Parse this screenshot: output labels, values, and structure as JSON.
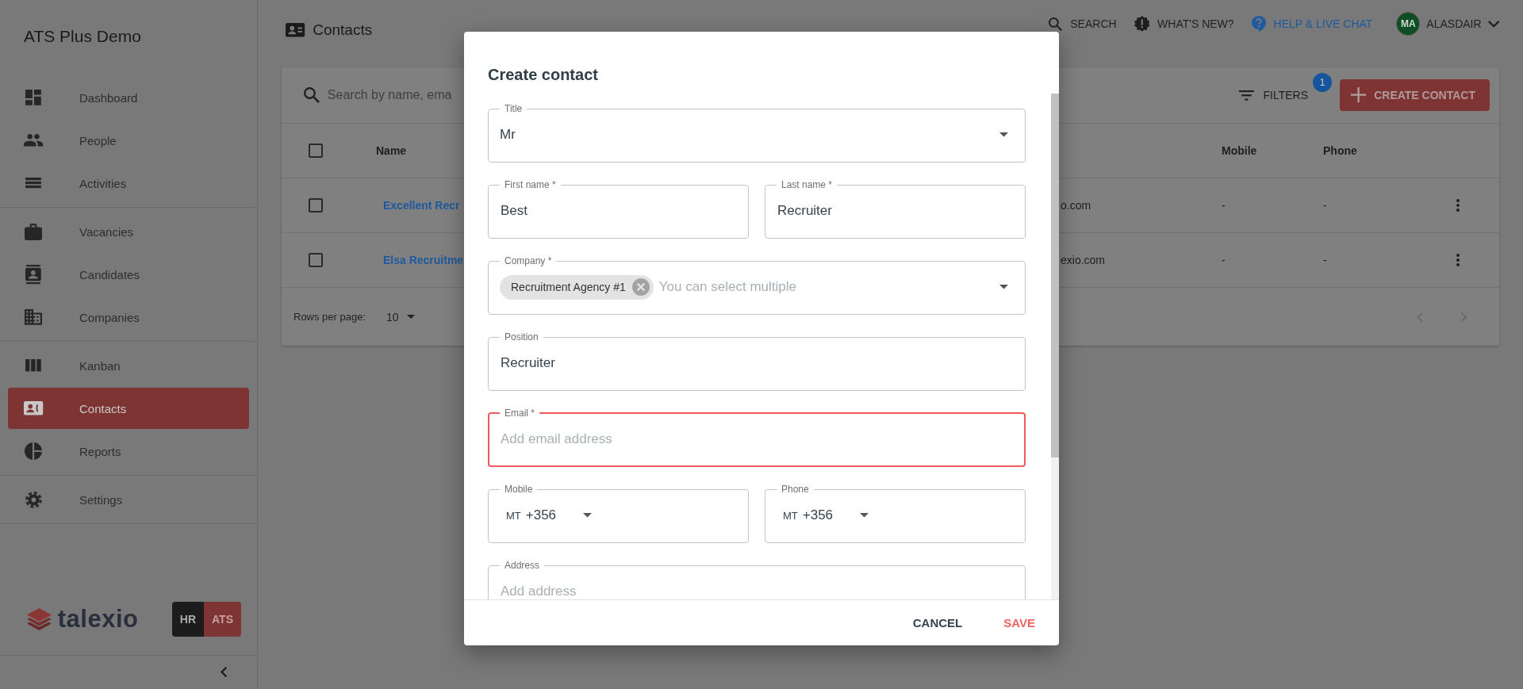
{
  "sidebar": {
    "title": "ATS Plus Demo",
    "sections": [
      {
        "items": [
          {
            "label": "Dashboard",
            "selected": false
          },
          {
            "label": "People",
            "selected": false
          },
          {
            "label": "Activities",
            "selected": false
          }
        ]
      },
      {
        "items": [
          {
            "label": "Vacancies",
            "selected": false
          },
          {
            "label": "Candidates",
            "selected": false
          },
          {
            "label": "Companies",
            "selected": false
          }
        ]
      },
      {
        "items": [
          {
            "label": "Kanban",
            "selected": false
          },
          {
            "label": "Contacts",
            "selected": true
          },
          {
            "label": "Reports",
            "selected": false
          }
        ]
      },
      {
        "items": [
          {
            "label": "Settings",
            "selected": false
          }
        ]
      }
    ],
    "logo": "talexio",
    "product_switch": [
      {
        "label": "HR",
        "selected": false
      },
      {
        "label": "ATS",
        "selected": true
      }
    ]
  },
  "header": {
    "title": "Contacts",
    "actions": [
      {
        "label": "SEARCH"
      },
      {
        "label": "WHAT'S NEW?"
      },
      {
        "label": "HELP & LIVE CHAT"
      }
    ],
    "user": {
      "initials": "MA",
      "name": "ALASDAIR"
    }
  },
  "toolbar": {
    "search_placeholder": "Search by name, ema",
    "filters": "FILTERS",
    "filter_count": "1",
    "create_button": "CREATE CONTACT"
  },
  "table": {
    "all_checked": false,
    "columns": [
      "Name",
      "Mobile",
      "Phone"
    ],
    "rows": [
      {
        "checked": false,
        "name": "Excellent Recr",
        "email": "o.com",
        "mobile": "-",
        "phone": "-"
      },
      {
        "checked": false,
        "name": "Elsa Recruitme",
        "email": "exio.com",
        "mobile": "-",
        "phone": "-"
      }
    ],
    "rows_per_page_label": "Rows per page:",
    "rows_per_page": "10"
  },
  "dialog": {
    "title": "Create contact",
    "rows": [
      [
        {
          "kind": "select",
          "label": "Title",
          "value": "Mr"
        }
      ],
      [
        {
          "kind": "text",
          "label": "First name *",
          "value": "Best"
        },
        {
          "kind": "text",
          "label": "Last name *",
          "value": "Recruiter"
        }
      ],
      [
        {
          "kind": "chips",
          "label": "Company *",
          "chips": [
            "Recruitment Agency #1"
          ],
          "placeholder": "You can select multiple"
        }
      ],
      [
        {
          "kind": "text",
          "label": "Position",
          "value": "Recruiter"
        }
      ],
      [
        {
          "kind": "text",
          "label": "Email *",
          "placeholder": "Add email address",
          "error": true
        }
      ],
      [
        {
          "kind": "phone",
          "label": "Mobile",
          "country": "MT",
          "code": "+356"
        },
        {
          "kind": "phone",
          "label": "Phone",
          "country": "MT",
          "code": "+356"
        }
      ],
      [
        {
          "kind": "text",
          "label": "Address",
          "placeholder": "Add address"
        }
      ]
    ],
    "buttons": [
      {
        "label": "CANCEL",
        "primary": false
      },
      {
        "label": "SAVE",
        "primary": true
      }
    ]
  }
}
